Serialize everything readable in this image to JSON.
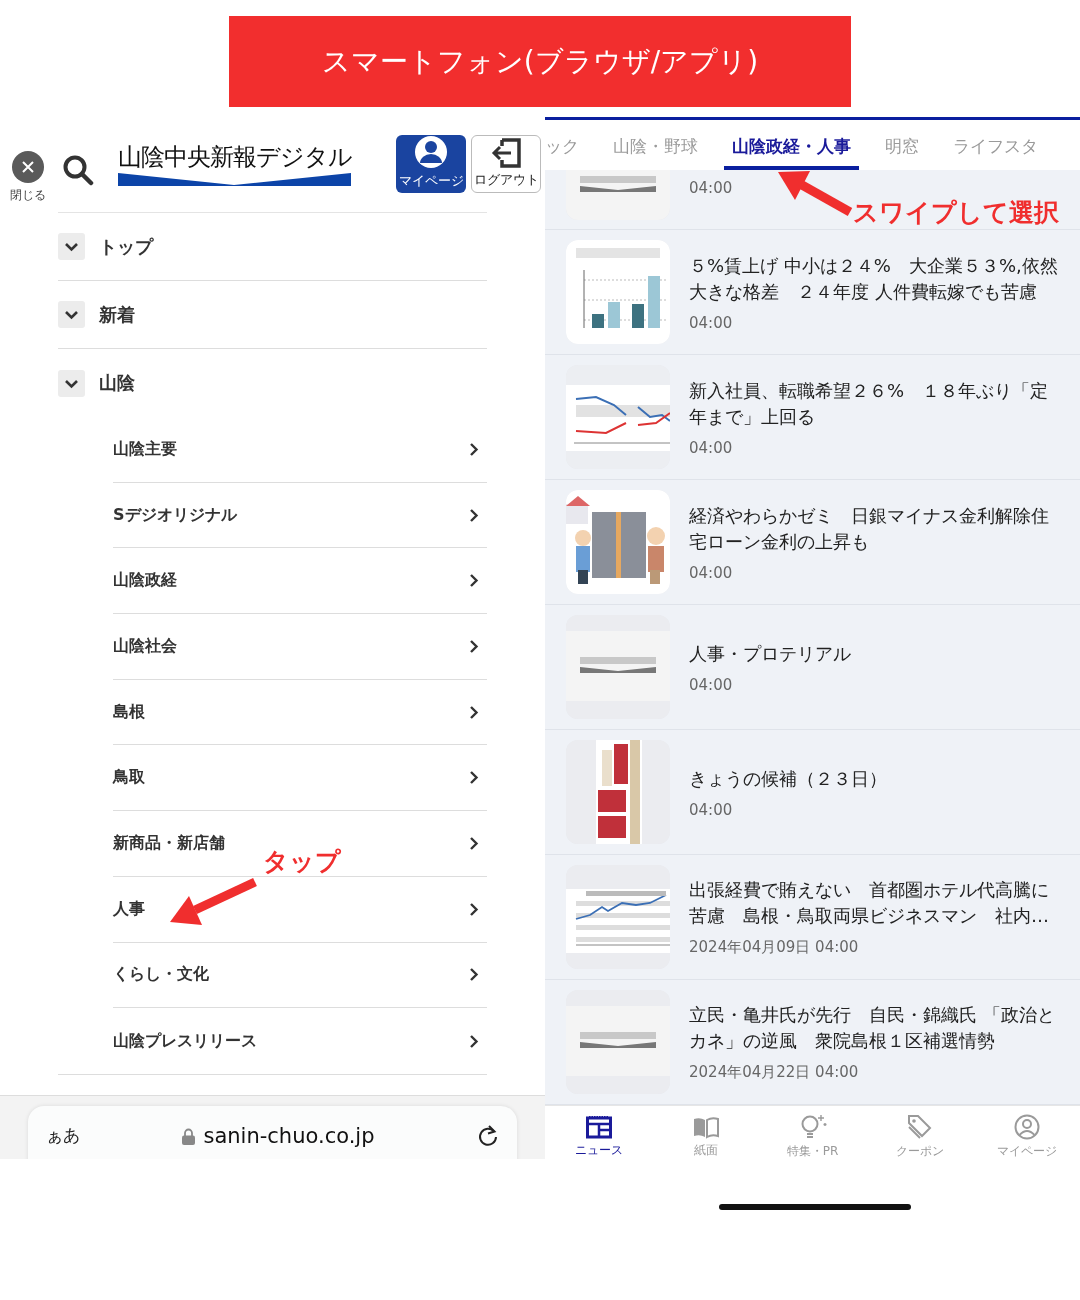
{
  "banner": {
    "title": "スマートフォン(ブラウザ/アプリ)"
  },
  "browser_view": {
    "close_label": "閉じる",
    "logo": "山陰中央新報デジタル",
    "mypage_label": "マイページ",
    "logout_label": "ログアウト",
    "menu": [
      {
        "label": "トップ"
      },
      {
        "label": "新着"
      },
      {
        "label": "山陰",
        "children": [
          {
            "label": "山陰主要"
          },
          {
            "label": "Sデジオリジナル"
          },
          {
            "label": "山陰政経"
          },
          {
            "label": "山陰社会"
          },
          {
            "label": "島根"
          },
          {
            "label": "鳥取"
          },
          {
            "label": "新商品・新店舗"
          },
          {
            "label": "人事"
          },
          {
            "label": "くらし・文化"
          },
          {
            "label": "山陰プレスリリース"
          }
        ]
      }
    ],
    "annotation": "タップ",
    "address_bar": {
      "text_size": "ぁあ",
      "url": "sanin-chuo.co.jp"
    }
  },
  "app_view": {
    "tabs": [
      {
        "label": "ック",
        "selected": false
      },
      {
        "label": "山陰・野球",
        "selected": false
      },
      {
        "label": "山陰政経・人事",
        "selected": true
      },
      {
        "label": "明窓",
        "selected": false
      },
      {
        "label": "ライフスタ",
        "selected": false
      }
    ],
    "articles": [
      {
        "time": "04:00"
      },
      {
        "title": "５%賃上げ 中小は２４%　大企業５３%,依然大きな格差　２４年度 人件費転嫁でも苦慮",
        "time": "04:00"
      },
      {
        "title": "新入社員、転職希望２６%　１８年ぶり「定年まで」上回る",
        "time": "04:00"
      },
      {
        "title": "経済やわらかゼミ　日銀マイナス金利解除住宅ローン金利の上昇も",
        "time": "04:00"
      },
      {
        "title": "人事・プロテリアル",
        "time": "04:00"
      },
      {
        "title": "きょうの候補（２３日）",
        "time": "04:00"
      },
      {
        "title": "出張経費で賄えない　首都圏ホテル代高騰に苦慮　島根・鳥取両県ビジネスマン　社内…",
        "time": "2024年04月09日 04:00"
      },
      {
        "title": "立民・亀井氏が先行　自民・錦織氏 「政治とカネ」の逆風　衆院島根１区補選情勢",
        "time": "2024年04月22日 04:00"
      }
    ],
    "annotation": "スワイプして選択",
    "nav": [
      {
        "label": "ニュース",
        "selected": true
      },
      {
        "label": "紙面",
        "selected": false
      },
      {
        "label": "特集・PR",
        "selected": false
      },
      {
        "label": "クーポン",
        "selected": false
      },
      {
        "label": "マイページ",
        "selected": false
      }
    ]
  }
}
